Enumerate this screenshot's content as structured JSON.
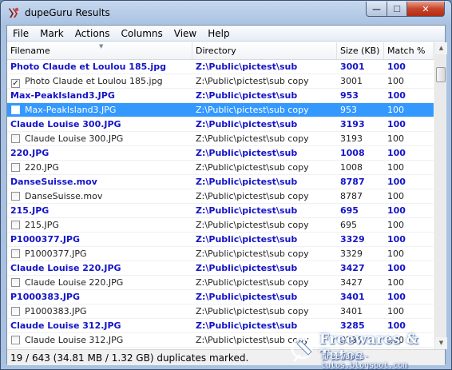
{
  "window": {
    "title": "dupeGuru Results",
    "controls": {
      "minimize": "—",
      "maximize": "☐",
      "close": "✕"
    }
  },
  "menu": [
    "File",
    "Mark",
    "Actions",
    "Columns",
    "View",
    "Help"
  ],
  "columns": [
    "Filename",
    "Directory",
    "Size (KB)",
    "Match %"
  ],
  "rows": [
    {
      "type": "ref",
      "filename": "Photo Claude et Loulou 185.jpg",
      "directory": "Z:\\Public\\pictest\\sub",
      "size": "3001",
      "match": "100"
    },
    {
      "type": "dup",
      "checked": true,
      "filename": "Photo Claude et Loulou 185.jpg",
      "directory": "Z:\\Public\\pictest\\sub copy",
      "size": "3001",
      "match": "100"
    },
    {
      "type": "ref",
      "filename": "Max-PeakIsland3.JPG",
      "directory": "Z:\\Public\\pictest\\sub",
      "size": "953",
      "match": "100"
    },
    {
      "type": "dup",
      "checked": false,
      "selected": true,
      "filename": "Max-PeakIsland3.JPG",
      "directory": "Z:\\Public\\pictest\\sub copy",
      "size": "953",
      "match": "100"
    },
    {
      "type": "ref",
      "filename": "Claude Louise 300.JPG",
      "directory": "Z:\\Public\\pictest\\sub",
      "size": "3193",
      "match": "100"
    },
    {
      "type": "dup",
      "checked": false,
      "filename": "Claude Louise 300.JPG",
      "directory": "Z:\\Public\\pictest\\sub copy",
      "size": "3193",
      "match": "100"
    },
    {
      "type": "ref",
      "filename": "220.JPG",
      "directory": "Z:\\Public\\pictest\\sub",
      "size": "1008",
      "match": "100"
    },
    {
      "type": "dup",
      "checked": false,
      "filename": "220.JPG",
      "directory": "Z:\\Public\\pictest\\sub copy",
      "size": "1008",
      "match": "100"
    },
    {
      "type": "ref",
      "filename": "DanseSuisse.mov",
      "directory": "Z:\\Public\\pictest\\sub",
      "size": "8787",
      "match": "100"
    },
    {
      "type": "dup",
      "checked": false,
      "filename": "DanseSuisse.mov",
      "directory": "Z:\\Public\\pictest\\sub copy",
      "size": "8787",
      "match": "100"
    },
    {
      "type": "ref",
      "filename": "215.JPG",
      "directory": "Z:\\Public\\pictest\\sub",
      "size": "695",
      "match": "100"
    },
    {
      "type": "dup",
      "checked": false,
      "filename": "215.JPG",
      "directory": "Z:\\Public\\pictest\\sub copy",
      "size": "695",
      "match": "100"
    },
    {
      "type": "ref",
      "filename": "P1000377.JPG",
      "directory": "Z:\\Public\\pictest\\sub",
      "size": "3329",
      "match": "100"
    },
    {
      "type": "dup",
      "checked": false,
      "filename": "P1000377.JPG",
      "directory": "Z:\\Public\\pictest\\sub copy",
      "size": "3329",
      "match": "100"
    },
    {
      "type": "ref",
      "filename": "Claude Louise 220.JPG",
      "directory": "Z:\\Public\\pictest\\sub",
      "size": "3427",
      "match": "100"
    },
    {
      "type": "dup",
      "checked": false,
      "filename": "Claude Louise 220.JPG",
      "directory": "Z:\\Public\\pictest\\sub copy",
      "size": "3427",
      "match": "100"
    },
    {
      "type": "ref",
      "filename": "P1000383.JPG",
      "directory": "Z:\\Public\\pictest\\sub",
      "size": "3401",
      "match": "100"
    },
    {
      "type": "dup",
      "checked": false,
      "filename": "P1000383.JPG",
      "directory": "Z:\\Public\\pictest\\sub copy",
      "size": "3401",
      "match": "100"
    },
    {
      "type": "ref",
      "filename": "Claude Louise 312.JPG",
      "directory": "Z:\\Public\\pictest\\sub",
      "size": "3285",
      "match": "100"
    },
    {
      "type": "dup",
      "checked": false,
      "filename": "Claude Louise 312.JPG",
      "directory": "Z:\\Public\\pictest\\sub copy",
      "size": "3285",
      "match": "100"
    }
  ],
  "status": "19 / 643 (34.81 MB / 1.32 GB) duplicates marked.",
  "watermark": {
    "title": "Freewares & Tutos",
    "url": "freewares-tutos.blogspot.com"
  },
  "colors": {
    "ref_text": "#1414c8",
    "selection": "#3399ff",
    "close_button": "#c7442a"
  }
}
